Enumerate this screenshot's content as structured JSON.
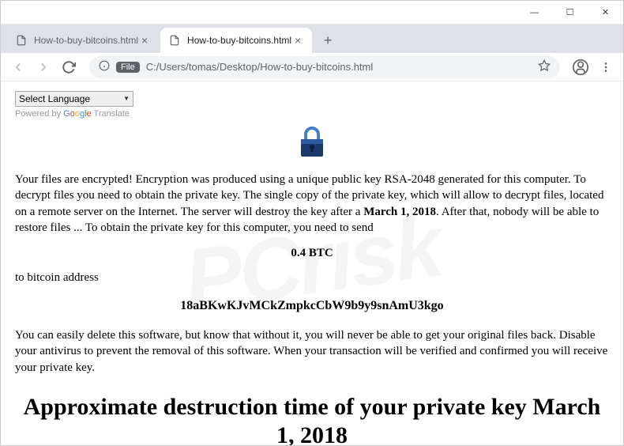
{
  "window": {
    "minimize": "—",
    "maximize": "☐",
    "close": "✕"
  },
  "tabs": [
    {
      "title": "How-to-buy-bitcoins.html",
      "active": false
    },
    {
      "title": "How-to-buy-bitcoins.html",
      "active": true
    }
  ],
  "toolbar": {
    "file_label": "File",
    "url": "C:/Users/tomas/Desktop/How-to-buy-bitcoins.html"
  },
  "translate": {
    "select_label": "Select Language",
    "powered_prefix": "Powered by ",
    "translate_word": " Translate"
  },
  "content": {
    "para1_prefix": "Your files are encrypted! Encryption was produced using a unique public key RSA-2048 generated for this computer. To decrypt files you need to obtain the private key. The single copy of the private key, which will allow to decrypt files, located on a remote server on the Internet. The server will destroy the key after a ",
    "para1_bold": "March 1, 2018",
    "para1_suffix": ". After that, nobody will be able to restore files ... To obtain the private key for this computer, you need to send",
    "amount": "0.4 BTC",
    "to_addr_label": "to bitcoin address",
    "btc_address": "18aBKwKJvMCkZmpkcCbW9b9y9snAmU3kgo",
    "para2": "You can easily delete this software, but know that without it, you will never be able to get your original files back. Disable your antivirus to prevent the removal of this software. When your transaction will be verified and confirmed you will receive your private key.",
    "heading": "Approximate destruction time of your private key March 1, 2018"
  },
  "watermark": "PCrisk"
}
